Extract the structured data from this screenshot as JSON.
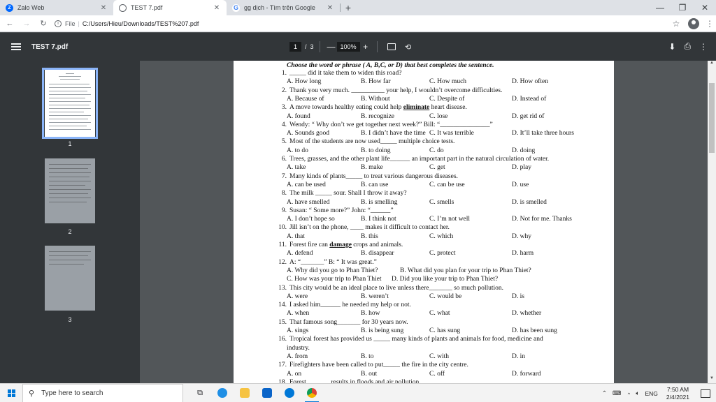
{
  "tabs": [
    {
      "title": "Zalo Web",
      "icon": "zalo-icon",
      "color": "#0068ff"
    },
    {
      "title": "TEST 7.pdf",
      "icon": "globe-icon",
      "color": "#5f6368"
    },
    {
      "title": "gg dịch - Tìm trên Google",
      "icon": "google-icon",
      "color": "#4285f4"
    }
  ],
  "address": {
    "scheme": "File",
    "path": "C:/Users/Hieu/Downloads/TEST%207.pdf"
  },
  "pdf": {
    "title": "TEST 7.pdf",
    "page_current": "1",
    "page_sep": "/",
    "page_total": "3",
    "zoom": "100%"
  },
  "thumbnails": [
    "1",
    "2",
    "3"
  ],
  "document": {
    "instruction": "Choose the word or phrase ( A, B,C, or D) that best completes the sentence.",
    "questions": [
      {
        "n": "1.",
        "parts": [
          "_____ did it take them to widen this road?"
        ],
        "opts": [
          "A. How long",
          "B. How far",
          "C. How much",
          "D. How often"
        ]
      },
      {
        "n": "2.",
        "parts": [
          "Thank you very much. __________ your help, I wouldn’t overcome difficulties."
        ],
        "opts": [
          "A. Because of",
          "B. Without",
          "C. Despite of",
          "D. Instead of"
        ]
      },
      {
        "n": "3.",
        "pre": "A move towards healthy eating could help ",
        "em": "eliminate",
        "post": " heart disease.",
        "opts": [
          "A. found",
          "B. recognize",
          "C. lose",
          "D. get rid of"
        ]
      },
      {
        "n": "4.",
        "parts": [
          "Wendy: “ Why don’t we get together next week?” Bill: “_______________”"
        ],
        "opts": [
          "A. Sounds good",
          "B. I didn’t have the time",
          "C. It was terrible",
          "D. It’ll take three hours"
        ]
      },
      {
        "n": "5.",
        "parts": [
          "Most of the students are now used_____ multiple choice tests."
        ],
        "opts": [
          "A. to do",
          "B. to doing",
          "C. do",
          "D. doing"
        ]
      },
      {
        "n": "6.",
        "parts": [
          "Trees, grasses, and the other plant life______ an important part in the natural circulation of water."
        ],
        "opts": [
          "A. take",
          "B. make",
          "C. get",
          "D. play"
        ]
      },
      {
        "n": "7.",
        "parts": [
          "Many kinds of plants_____ to treat various dangerous diseases."
        ],
        "opts": [
          "A. can be used",
          "B. can use",
          "C. can be use",
          "D. use"
        ]
      },
      {
        "n": "8.",
        "parts": [
          "The milk _____ sour. Shall I throw it away?"
        ],
        "opts": [
          "A. have smelled",
          "B. is smelling",
          "C. smells",
          "D. is smelled"
        ]
      },
      {
        "n": "9.",
        "parts": [
          "Susan: “ Some more?” John: “______”"
        ],
        "opts": [
          "A. I don’t hope so",
          "B. I think not",
          "C. I’m not well",
          "D. Not for me. Thanks"
        ]
      },
      {
        "n": "10.",
        "parts": [
          "Jill isn’t on the phone, ____ makes it difficult to contact her."
        ],
        "opts": [
          "A. that",
          "B. this",
          "C. which",
          "D. why"
        ]
      },
      {
        "n": "11.",
        "pre": "Forest fire can ",
        "em": "damage",
        "post": " crops and animals.",
        "opts": [
          "A. defend",
          "B. disappear",
          "C. protect",
          "D. harm"
        ]
      },
      {
        "n": "12.",
        "parts": [
          "A: “_______” B: “ It was great.”"
        ],
        "opts2": [
          "A. Why did you go to Phan Thiet?",
          "B. What did you plan for your trip to Phan Thiet?",
          "C. How was your trip to Phan Thiet",
          "D. Did you like your trip to Phan Thiet?"
        ]
      },
      {
        "n": "13.",
        "parts": [
          "This city would be an ideal place to live unless there_______ so much pollution."
        ],
        "opts": [
          "A. were",
          "B. weren’t",
          "C. would be",
          "D. is"
        ]
      },
      {
        "n": "14.",
        "parts": [
          "I asked him______ he needed my help or not."
        ],
        "opts": [
          "A. when",
          "B. how",
          "C. what",
          "D. whether"
        ]
      },
      {
        "n": "15.",
        "parts": [
          "That famous song_______ for 30 years now."
        ],
        "opts": [
          "A. sings",
          "B. is being sung",
          "C. has sung",
          "D. has been sung"
        ]
      },
      {
        "n": "16.",
        "parts": [
          "Tropical forest has provided us _____ many kinds of plants and animals for food, medicine and",
          "industry."
        ],
        "opts": [
          "A. from",
          "B. to",
          "C. with",
          "D. in"
        ]
      },
      {
        "n": "17.",
        "parts": [
          "Firefighters have been called to put_____ the fire in the city centre."
        ],
        "opts": [
          "A. on",
          "B. out",
          "C. off",
          "D. forward"
        ]
      },
      {
        "n": "18.",
        "parts": [
          "Forest_______ results in floods and air pollution."
        ]
      }
    ]
  },
  "taskbar": {
    "search_placeholder": "Type here to search",
    "lang": "ENG",
    "time": "7:50 AM",
    "date": "2/4/2021"
  },
  "colors": {
    "accent": "#8ab4f8",
    "pdf_toolbar": "#323639",
    "viewer_bg": "#525659"
  }
}
